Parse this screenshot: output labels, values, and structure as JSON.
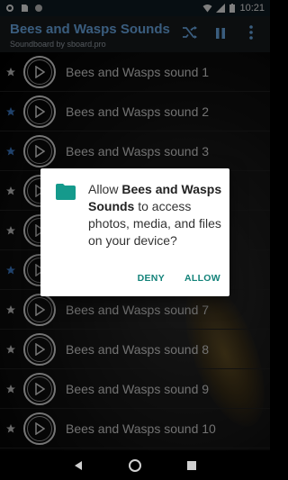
{
  "status_bar": {
    "time": "10:21",
    "icons": [
      "settings-icon",
      "sd-card-icon",
      "circle-notification-icon",
      "wifi-icon",
      "signal-icon",
      "battery-icon"
    ]
  },
  "app_bar": {
    "title": "Bees and Wasps Sounds",
    "subtitle": "Soundboard by sboard.pro",
    "actions": [
      "shuffle-icon",
      "pause-icon",
      "more-vert-icon"
    ]
  },
  "colors": {
    "title": "#6aa9e6",
    "star_favorite": "#3b78c4",
    "star_default": "#bdbdbd",
    "dialog_button": "#14837a",
    "folder_icon": "#159a8c"
  },
  "sounds": [
    {
      "label": "Bees and Wasps sound 1",
      "favorite": false
    },
    {
      "label": "Bees and Wasps sound 2",
      "favorite": true
    },
    {
      "label": "Bees and Wasps sound 3",
      "favorite": true
    },
    {
      "label": "",
      "favorite": false
    },
    {
      "label": "",
      "favorite": false
    },
    {
      "label": "",
      "favorite": true
    },
    {
      "label": "Bees and Wasps sound 7",
      "favorite": false
    },
    {
      "label": "Bees and Wasps sound 8",
      "favorite": false
    },
    {
      "label": "Bees and Wasps sound 9",
      "favorite": false
    },
    {
      "label": "Bees and Wasps sound 10",
      "favorite": false
    }
  ],
  "dialog": {
    "text_prefix": "Allow ",
    "app_name": "Bees and Wasps Sounds",
    "text_suffix": " to access photos, media, and files on your device?",
    "deny_label": "DENY",
    "allow_label": "ALLOW"
  }
}
